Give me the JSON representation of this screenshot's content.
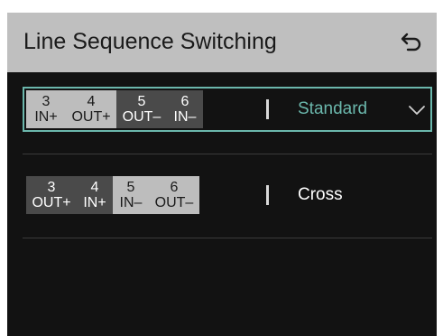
{
  "header": {
    "title": "Line Sequence Switching",
    "back_icon": "return-arrow-icon"
  },
  "options": {
    "standard": {
      "label": "Standard",
      "selected": true,
      "accent_color": "#6bb7ac",
      "check_icon": "check-icon",
      "pins": [
        {
          "num": "3",
          "sig": "IN+"
        },
        {
          "num": "4",
          "sig": "OUT+"
        },
        {
          "num": "5",
          "sig": "OUT–"
        },
        {
          "num": "6",
          "sig": "IN–"
        }
      ]
    },
    "cross": {
      "label": "Cross",
      "selected": false,
      "pins": [
        {
          "num": "3",
          "sig": "OUT+"
        },
        {
          "num": "4",
          "sig": "IN+"
        },
        {
          "num": "5",
          "sig": "IN–"
        },
        {
          "num": "6",
          "sig": "OUT–"
        }
      ]
    }
  }
}
